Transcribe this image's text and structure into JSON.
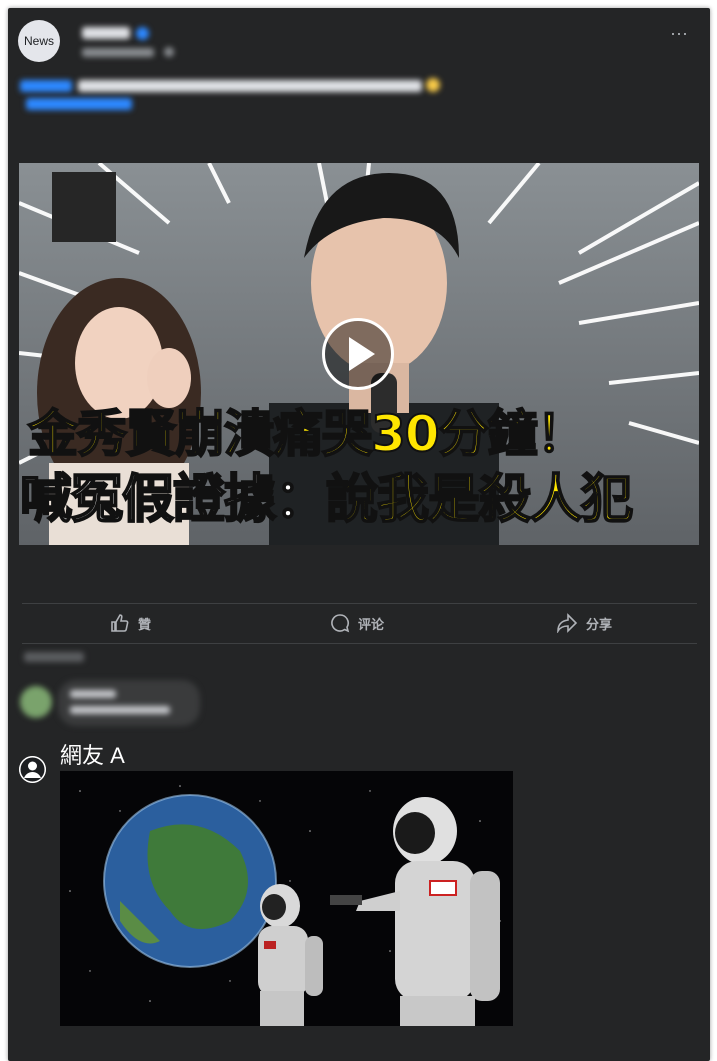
{
  "post": {
    "avatar_label": "News"
  },
  "headline": {
    "line1": "金秀賢崩潰痛哭30分鐘！",
    "line2_white": "喊冤假證據：",
    "line2_yellow": "說我是殺人犯"
  },
  "actions": {
    "like": "贊",
    "comment": "评论",
    "share": "分享"
  },
  "reply": {
    "user_name": "網友 A"
  },
  "colors": {
    "card_bg": "#242526",
    "accent_blue": "#2d88ff",
    "headline_yellow": "#ffe600",
    "action_text": "#b0b3b8"
  },
  "icons": [
    "like-icon",
    "comment-icon",
    "share-icon",
    "play-icon",
    "user-avatar-icon",
    "more-options-icon",
    "verified-icon",
    "globe-icon"
  ]
}
